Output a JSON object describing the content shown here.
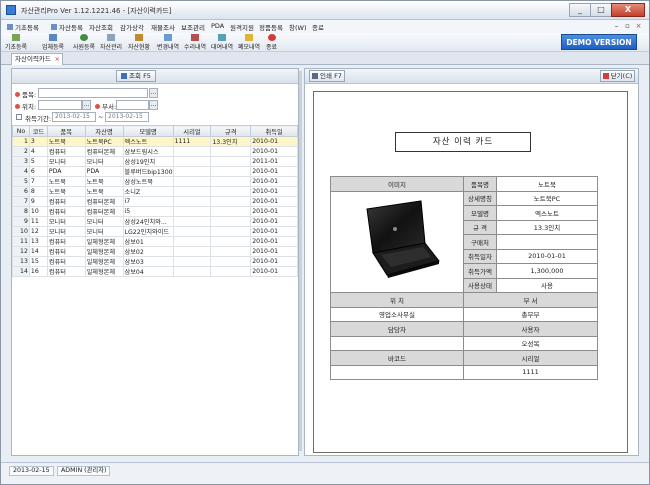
{
  "window": {
    "title": "자산관리Pro Ver 1.12.1221.46 - [자산이력카드]",
    "controls": [
      "_",
      "□",
      "X"
    ]
  },
  "menu": [
    "기초등록",
    "자산등록",
    "자산조회",
    "감가상각",
    "재물조사",
    "보조관리",
    "PDA",
    "원격지원",
    "정품등록",
    "창(W)",
    "종료"
  ],
  "toolbar": [
    "기초등록",
    "업체등록",
    "사원등록",
    "자산관리",
    "자산현황",
    "변경내역",
    "수리내역",
    "대여내역",
    "폐모내역",
    "종료"
  ],
  "demo_label": "DEMO VERSION",
  "tab": {
    "label": "자산이력카드",
    "close": "×"
  },
  "left": {
    "search_button": "조회 F5",
    "filters": {
      "item_label": "품목:",
      "location_label": "위치:",
      "dept_label": "부서:",
      "period_label": "취득기간:",
      "date_from": "2013-02-15",
      "date_sep": "~",
      "date_to": "2013-02-15"
    },
    "grid": {
      "headers": [
        "No",
        "코드",
        "품목",
        "자산명",
        "모델명",
        "시리얼",
        "규격",
        "취득일"
      ],
      "rows": [
        [
          "1",
          "3",
          "노트북",
          "노트북PC",
          "엑스노트",
          "1111",
          "13.3인치",
          "2010-01"
        ],
        [
          "2",
          "4",
          "컴퓨터",
          "컴퓨터본체",
          "삼보드림시스",
          "",
          "",
          "2010-01"
        ],
        [
          "3",
          "5",
          "모니터",
          "모니터",
          "삼성19인치",
          "",
          "",
          "2011-01"
        ],
        [
          "4",
          "6",
          "PDA",
          "PDA",
          "블루버드bip1300",
          "",
          "",
          "2010-01"
        ],
        [
          "5",
          "7",
          "노트북",
          "노트북",
          "삼성노트북",
          "",
          "",
          "2010-01"
        ],
        [
          "6",
          "8",
          "노트북",
          "노트북",
          "소니Z",
          "",
          "",
          "2010-01"
        ],
        [
          "7",
          "9",
          "컴퓨터",
          "컴퓨터본체",
          "i7",
          "",
          "",
          "2010-01"
        ],
        [
          "8",
          "10",
          "컴퓨터",
          "컴퓨터본체",
          "i5",
          "",
          "",
          "2010-01"
        ],
        [
          "9",
          "11",
          "모니터",
          "모니터",
          "삼성24인치와...",
          "",
          "",
          "2010-01"
        ],
        [
          "10",
          "12",
          "모니터",
          "모니터",
          "LG22인치와이드",
          "",
          "",
          "2010-01"
        ],
        [
          "11",
          "13",
          "컴퓨터",
          "일체형본체",
          "삼보01",
          "",
          "",
          "2010-01"
        ],
        [
          "12",
          "14",
          "컴퓨터",
          "일체형본체",
          "삼보02",
          "",
          "",
          "2010-01"
        ],
        [
          "13",
          "15",
          "컴퓨터",
          "일체형본체",
          "삼보03",
          "",
          "",
          "2010-01"
        ],
        [
          "14",
          "16",
          "컴퓨터",
          "일체형본체",
          "삼보04",
          "",
          "",
          "2010-01"
        ]
      ]
    }
  },
  "right": {
    "print_button": "인쇄 F7",
    "close_button": "닫기(C)",
    "card": {
      "title": "자산 이력 카드",
      "image_header": "이미지",
      "fields": [
        {
          "label": "품목명",
          "value": "노트북"
        },
        {
          "label": "상세명칭",
          "value": "노트북PC"
        },
        {
          "label": "모델명",
          "value": "엑스노트"
        },
        {
          "label": "규 격",
          "value": "13.3인치"
        },
        {
          "label": "구매처",
          "value": ""
        },
        {
          "label": "취득일자",
          "value": "2010-01-01"
        },
        {
          "label": "취득가액",
          "value": "1,300,000"
        },
        {
          "label": "사용상태",
          "value": "사용"
        }
      ],
      "location_header": "위 치",
      "dept_header": "부 서",
      "location_value": "영업소사무실",
      "dept_value": "총무부",
      "manager_header": "담당자",
      "user_header": "사용자",
      "manager_value": "",
      "user_value": "오성목",
      "barcode_header": "바코드",
      "serial_header": "시리얼",
      "barcode_value": "",
      "serial_value": "1111"
    }
  },
  "status": {
    "date": "2013-02-15",
    "user": "ADMIN (관리자)"
  },
  "colors": {
    "demo": "#1f5fbf",
    "required_dot": "#d9534f",
    "selected_row": "#fff6c8"
  }
}
